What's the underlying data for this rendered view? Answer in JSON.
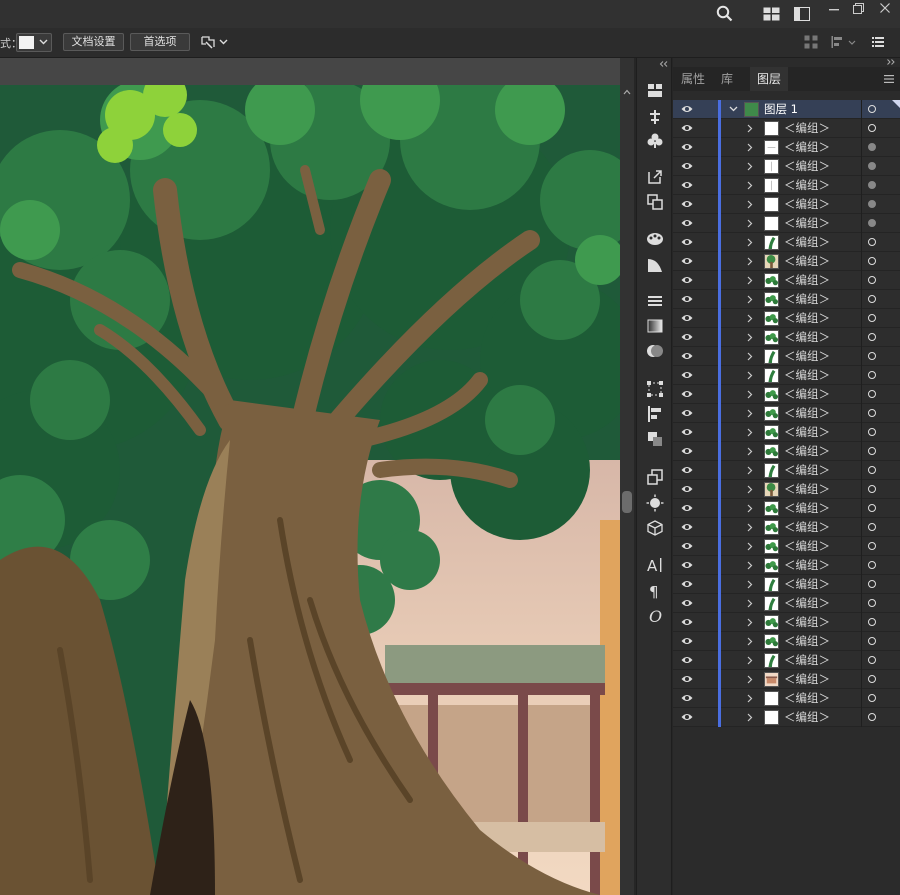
{
  "control_bar": {
    "style_label": "式：",
    "doc_setup_label": "文档设置",
    "preferences_label": "首选项"
  },
  "panel": {
    "tabs": [
      {
        "label": "属性",
        "active": false
      },
      {
        "label": "库",
        "active": false
      },
      {
        "label": "图层",
        "active": true
      }
    ],
    "layer": {
      "name": "图层 1"
    },
    "groups": [
      {
        "label": "＜编组＞",
        "thumb": "white",
        "target_filled": false
      },
      {
        "label": "＜编组＞",
        "thumb": "white-dash",
        "target_filled": true
      },
      {
        "label": "＜编组＞",
        "thumb": "white-vline",
        "target_filled": true
      },
      {
        "label": "＜编组＞",
        "thumb": "white-vline",
        "target_filled": true
      },
      {
        "label": "＜编组＞",
        "thumb": "white",
        "target_filled": true
      },
      {
        "label": "＜编组＞",
        "thumb": "white",
        "target_filled": true
      },
      {
        "label": "＜编组＞",
        "thumb": "green-branch",
        "target_filled": false
      },
      {
        "label": "＜编组＞",
        "thumb": "tree",
        "target_filled": false
      },
      {
        "label": "＜编组＞",
        "thumb": "leaves",
        "target_filled": false
      },
      {
        "label": "＜编组＞",
        "thumb": "leaves",
        "target_filled": false
      },
      {
        "label": "＜编组＞",
        "thumb": "leaves",
        "target_filled": false
      },
      {
        "label": "＜编组＞",
        "thumb": "leaves",
        "target_filled": false
      },
      {
        "label": "＜编组＞",
        "thumb": "green-branch",
        "target_filled": false
      },
      {
        "label": "＜编组＞",
        "thumb": "green-branch",
        "target_filled": false
      },
      {
        "label": "＜编组＞",
        "thumb": "leaves",
        "target_filled": false
      },
      {
        "label": "＜编组＞",
        "thumb": "leaves",
        "target_filled": false
      },
      {
        "label": "＜编组＞",
        "thumb": "leaves",
        "target_filled": false
      },
      {
        "label": "＜编组＞",
        "thumb": "leaves",
        "target_filled": false
      },
      {
        "label": "＜编组＞",
        "thumb": "green-branch",
        "target_filled": false
      },
      {
        "label": "＜编组＞",
        "thumb": "tree",
        "target_filled": false
      },
      {
        "label": "＜编组＞",
        "thumb": "leaves",
        "target_filled": false
      },
      {
        "label": "＜编组＞",
        "thumb": "leaves",
        "target_filled": false
      },
      {
        "label": "＜编组＞",
        "thumb": "leaves",
        "target_filled": false
      },
      {
        "label": "＜编组＞",
        "thumb": "leaves",
        "target_filled": false
      },
      {
        "label": "＜编组＞",
        "thumb": "green-branch",
        "target_filled": false
      },
      {
        "label": "＜编组＞",
        "thumb": "green-branch",
        "target_filled": false
      },
      {
        "label": "＜编组＞",
        "thumb": "leaves",
        "target_filled": false
      },
      {
        "label": "＜编组＞",
        "thumb": "leaves",
        "target_filled": false
      },
      {
        "label": "＜编组＞",
        "thumb": "green-branch",
        "target_filled": false
      },
      {
        "label": "＜编组＞",
        "thumb": "building",
        "target_filled": false
      },
      {
        "label": "＜编组＞",
        "thumb": "white",
        "target_filled": false
      },
      {
        "label": "＜编组＞",
        "thumb": "white",
        "target_filled": false
      }
    ]
  },
  "colors": {
    "accent": "#4a6ee0",
    "selected_row": "#354056"
  }
}
